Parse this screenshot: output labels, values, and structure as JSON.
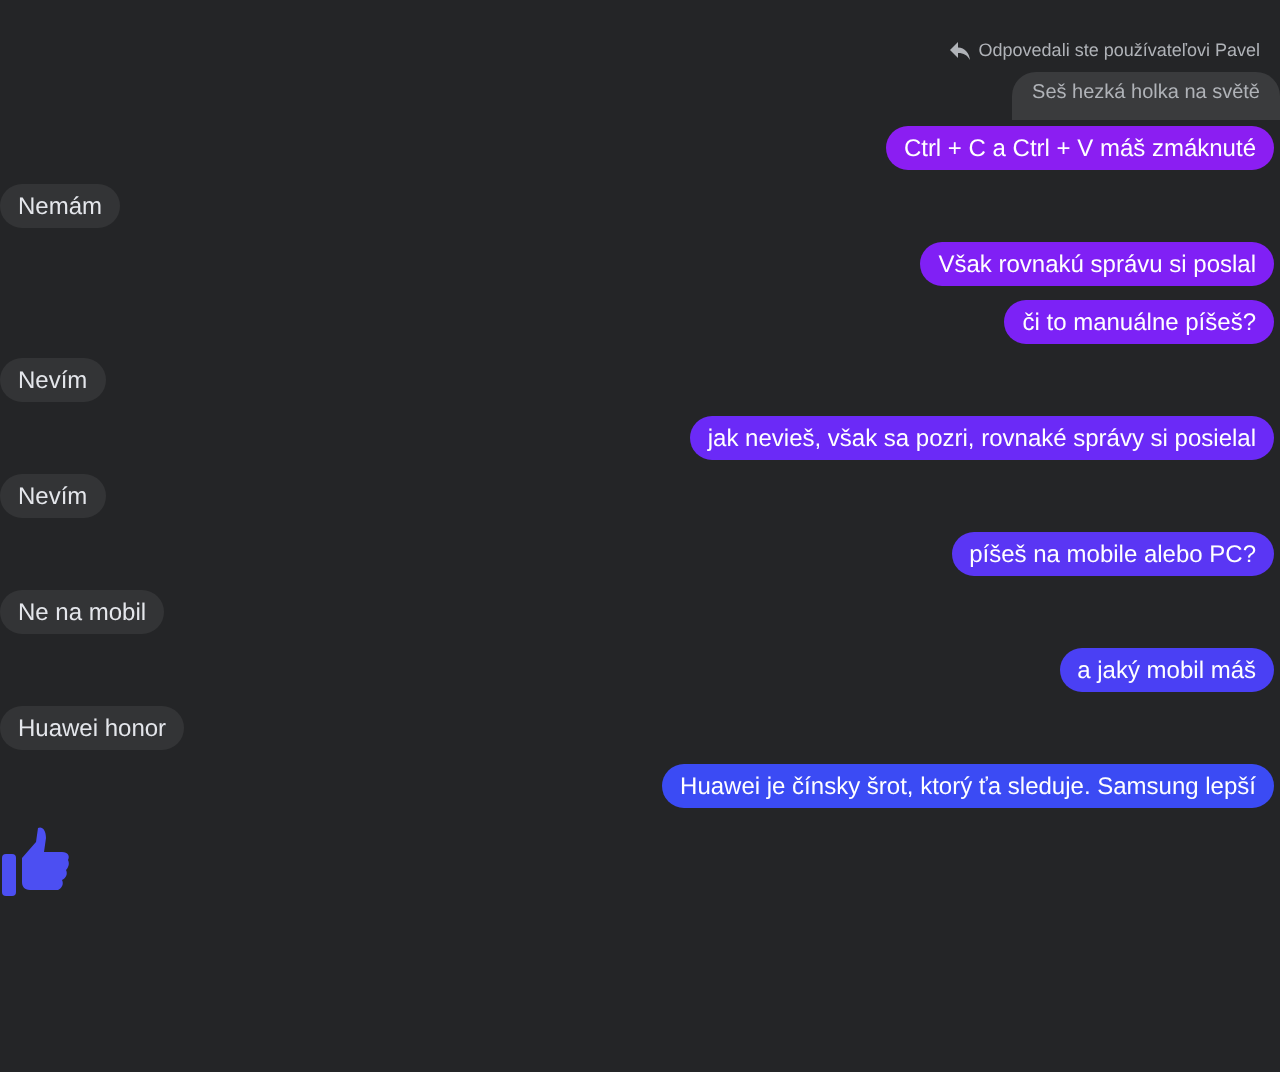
{
  "reply_note": "Odpovedali ste používateľovi Pavel",
  "messages": [
    {
      "kind": "quoted",
      "text": "Seš hezká holka na světě"
    },
    {
      "kind": "sent",
      "text": "Ctrl + C a Ctrl + V máš zmáknuté",
      "color": "#8b1ef2"
    },
    {
      "kind": "received",
      "text": "Nemám"
    },
    {
      "kind": "sent",
      "text": "Však rovnakú správu si poslal",
      "color": "#8020f5"
    },
    {
      "kind": "sent",
      "text": "či to manuálne píšeš?",
      "color": "#7c22f6"
    },
    {
      "kind": "received",
      "text": "Nevím"
    },
    {
      "kind": "sent",
      "text": "jak nevieš, však sa pozri, rovnaké správy si posielal",
      "color": "#6b2af7"
    },
    {
      "kind": "received",
      "text": "Nevím"
    },
    {
      "kind": "sent",
      "text": "píšeš na mobile alebo PC?",
      "color": "#5a36f4"
    },
    {
      "kind": "received",
      "text": "Ne na mobil"
    },
    {
      "kind": "sent",
      "text": "a jaký mobil máš",
      "color": "#4a40f4"
    },
    {
      "kind": "received",
      "text": "Huawei honor"
    },
    {
      "kind": "sent",
      "text": "Huawei je čínsky šrot, ktorý ťa sleduje. Samsung lepší",
      "color": "#3b4bf4"
    },
    {
      "kind": "like",
      "color": "#4c4ff2"
    }
  ]
}
